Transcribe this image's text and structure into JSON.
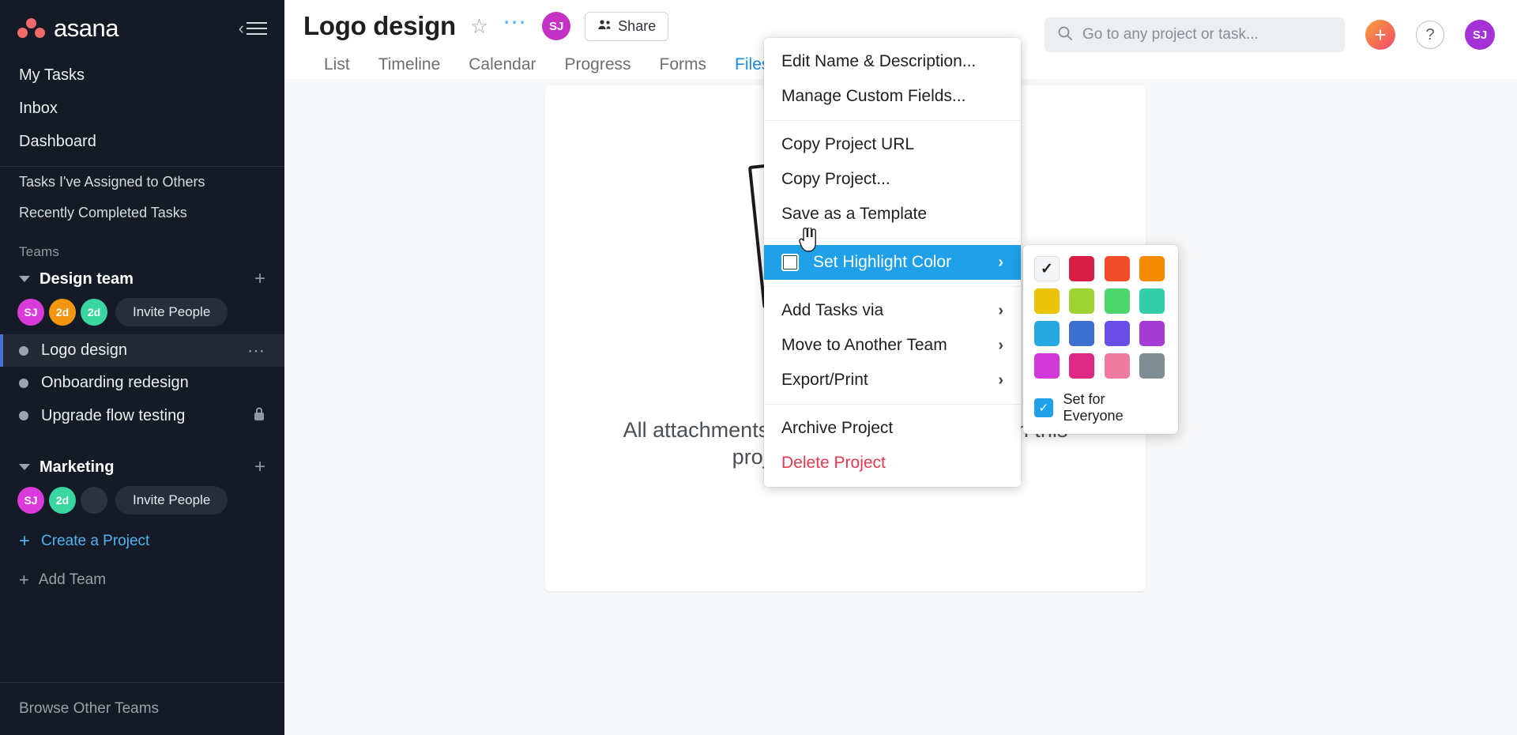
{
  "brand": {
    "name": "asana",
    "logo_color": "#f06a6a"
  },
  "sidebar": {
    "nav": [
      {
        "label": "My Tasks"
      },
      {
        "label": "Inbox"
      },
      {
        "label": "Dashboard"
      }
    ],
    "sub_nav": [
      {
        "label": "Tasks I've Assigned to Others"
      },
      {
        "label": "Recently Completed Tasks"
      }
    ],
    "teams_heading": "Teams",
    "teams": [
      {
        "name": "Design team",
        "invite_label": "Invite People",
        "avatars": [
          {
            "initials": "SJ",
            "color": "#d93ad9"
          },
          {
            "initials": "2d",
            "color": "#f2960f"
          },
          {
            "initials": "2d",
            "color": "#39d6a0"
          }
        ],
        "projects": [
          {
            "name": "Logo design",
            "active": true,
            "menu": "⋯"
          },
          {
            "name": "Onboarding redesign",
            "active": false
          },
          {
            "name": "Upgrade flow testing",
            "active": false,
            "lock": "🔒"
          }
        ]
      },
      {
        "name": "Marketing",
        "invite_label": "Invite People",
        "avatars": [
          {
            "initials": "SJ",
            "color": "#d93ad9"
          },
          {
            "initials": "2d",
            "color": "#39d6a0"
          },
          {
            "initials": "",
            "color": "#2b3240"
          }
        ],
        "projects": []
      }
    ],
    "create_project_label": "Create a Project",
    "add_team_label": "Add Team",
    "browse_other_teams_label": "Browse Other Teams"
  },
  "header": {
    "project_title": "Logo design",
    "star_icon": "☆",
    "overflow_icon": "⋯",
    "owner_avatar": {
      "initials": "SJ",
      "color": "#c431c4"
    },
    "share_label": "Share",
    "tabs": [
      {
        "label": "List",
        "active": false
      },
      {
        "label": "Timeline",
        "active": false
      },
      {
        "label": "Calendar",
        "active": false
      },
      {
        "label": "Progress",
        "active": false
      },
      {
        "label": "Forms",
        "active": false
      },
      {
        "label": "Files",
        "active": true
      }
    ]
  },
  "topbar": {
    "search_placeholder": "Go to any project or task...",
    "search_value": "",
    "plus_label": "+",
    "help_label": "?",
    "user_avatar": {
      "initials": "SJ",
      "color": "#a532d6"
    }
  },
  "empty_state": {
    "message": "All attachments to tasks & conversations in this project will appear here."
  },
  "menu": {
    "groups": [
      {
        "items": [
          {
            "label": "Edit Name & Description...",
            "submenu": false
          },
          {
            "label": "Manage Custom Fields...",
            "submenu": false
          }
        ]
      },
      {
        "items": [
          {
            "label": "Copy Project URL",
            "submenu": false
          },
          {
            "label": "Copy Project...",
            "submenu": false
          },
          {
            "label": "Save as a Template",
            "submenu": false
          }
        ]
      },
      {
        "items": [
          {
            "label": "Set Highlight Color",
            "submenu": true,
            "selected": true,
            "has_color_box": true,
            "arrow": "›"
          }
        ]
      },
      {
        "items": [
          {
            "label": "Add Tasks via",
            "submenu": true,
            "arrow": "›"
          },
          {
            "label": "Move to Another Team",
            "submenu": true,
            "arrow": "›"
          },
          {
            "label": "Export/Print",
            "submenu": true,
            "arrow": "›"
          }
        ]
      },
      {
        "items": [
          {
            "label": "Archive Project",
            "submenu": false
          },
          {
            "label": "Delete Project",
            "submenu": false,
            "danger": true
          }
        ]
      }
    ]
  },
  "color_submenu": {
    "swatches": [
      {
        "name": "none",
        "color": "#f4f5f6",
        "selected": true,
        "check": "✓"
      },
      {
        "name": "crimson",
        "color": "#d81e47"
      },
      {
        "name": "red-orange",
        "color": "#f04d28"
      },
      {
        "name": "orange",
        "color": "#f28b00"
      },
      {
        "name": "yellow",
        "color": "#eac30a"
      },
      {
        "name": "yellow-green",
        "color": "#9ed333"
      },
      {
        "name": "green",
        "color": "#4ed66d"
      },
      {
        "name": "teal",
        "color": "#32ceaa"
      },
      {
        "name": "light-blue",
        "color": "#28a8e0"
      },
      {
        "name": "blue",
        "color": "#3c6fd0"
      },
      {
        "name": "indigo",
        "color": "#6a4fe6"
      },
      {
        "name": "purple",
        "color": "#a43cd4"
      },
      {
        "name": "magenta",
        "color": "#d038d8"
      },
      {
        "name": "pink",
        "color": "#dd2986"
      },
      {
        "name": "hot-pink",
        "color": "#f07ba0"
      },
      {
        "name": "cool-gray",
        "color": "#7f8e95"
      }
    ],
    "set_for_everyone": {
      "label": "Set for Everyone",
      "checked": true,
      "check": "✓",
      "color": "#1fa0e8"
    }
  }
}
